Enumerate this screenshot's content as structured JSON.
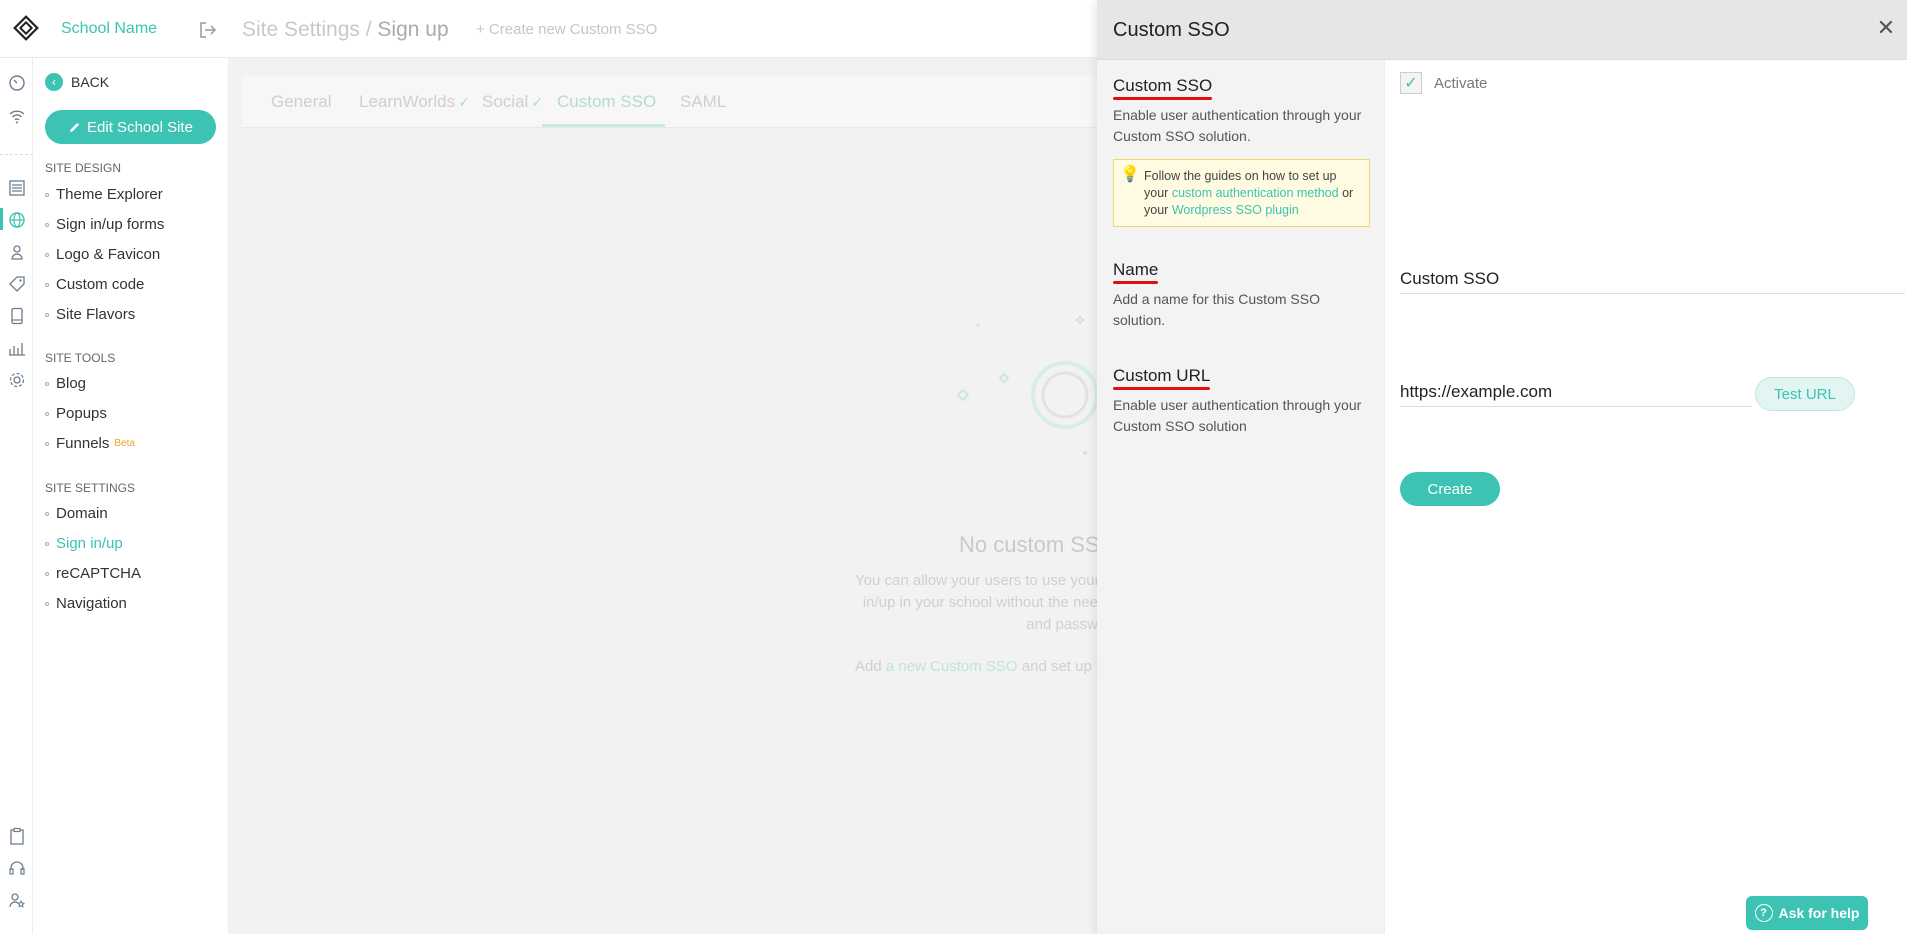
{
  "app": {
    "school_name": "School Name",
    "breadcrumb_parent": "Site Settings /",
    "breadcrumb_current": "Sign up",
    "create_link": "+ Create new Custom SSO",
    "accent_color": "#3cc3b4"
  },
  "sidebar": {
    "back_label": "BACK",
    "edit_button": "Edit School Site",
    "sections": [
      {
        "title": "SITE DESIGN",
        "items": [
          "Theme Explorer",
          "Sign in/up forms",
          "Logo & Favicon",
          "Custom code",
          "Site Flavors"
        ]
      },
      {
        "title": "SITE TOOLS",
        "items": [
          "Blog",
          "Popups",
          "Funnels"
        ]
      },
      {
        "title": "SITE SETTINGS",
        "items": [
          "Domain",
          "Sign in/up",
          "reCAPTCHA",
          "Navigation"
        ]
      }
    ],
    "funnels_badge": "Beta",
    "active_item": "Sign in/up"
  },
  "tabs": [
    "General",
    "LearnWorlds",
    "Social",
    "Custom SSO",
    "SAML"
  ],
  "active_tab": "Custom SSO",
  "empty_state": {
    "title": "No custom SSO",
    "line1": "You can allow your users to use your",
    "line2": "in/up in your school without the nee",
    "line3": "and passw",
    "add_prefix": "Add",
    "add_link": "a new Custom SSO",
    "add_suffix": "and set up y"
  },
  "panel": {
    "title": "Custom SSO",
    "activate_label": "Activate",
    "activate_checked": true,
    "sso_label": "Custom SSO",
    "sso_desc": "Enable user authentication through your Custom SSO solution.",
    "tip_text_1": "Follow the guides on how to set up your",
    "tip_link_1": "custom authentication method",
    "tip_text_2": "or your",
    "tip_link_2": "Wordpress SSO plugin",
    "name_label": "Name",
    "name_desc": "Add a name for this Custom SSO solution.",
    "name_value": "Custom SSO",
    "url_label": "Custom URL",
    "url_desc": "Enable user authentication through your Custom SSO solution",
    "url_value": "https://example.com",
    "test_button": "Test URL",
    "create_button": "Create"
  },
  "help_button": "Ask for help"
}
